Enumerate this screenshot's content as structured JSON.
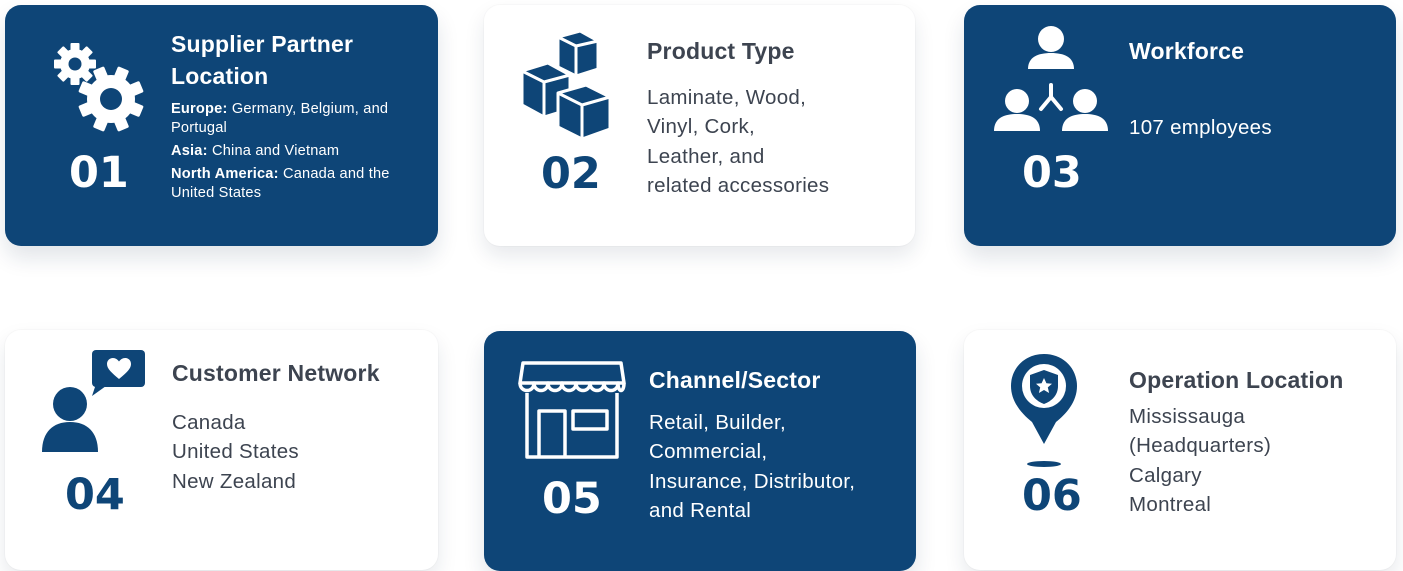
{
  "cards": [
    {
      "number": "01",
      "title_line1": "Supplier Partner",
      "title_line2": "Location",
      "icon": "gears-icon",
      "locations": [
        {
          "region": "Europe:",
          "countries": "Germany, Belgium, and Portugal"
        },
        {
          "region": "Asia:",
          "countries": "China and Vietnam"
        },
        {
          "region": "North America:",
          "countries": "Canada and the United States"
        }
      ]
    },
    {
      "number": "02",
      "title": "Product Type",
      "icon": "boxes-icon",
      "lines": [
        "Laminate, Wood,",
        "Vinyl, Cork,",
        "Leather, and",
        "related accessories"
      ]
    },
    {
      "number": "03",
      "title": "Workforce",
      "icon": "team-icon",
      "lines": [
        "107 employees"
      ]
    },
    {
      "number": "04",
      "title": "Customer Network",
      "icon": "customer-chat-heart-icon",
      "lines": [
        "Canada",
        "United States",
        "New Zealand"
      ]
    },
    {
      "number": "05",
      "title": "Channel/Sector",
      "icon": "storefront-icon",
      "lines": [
        "Retail, Builder,",
        "Commercial,",
        "Insurance, Distributor,",
        "and Rental"
      ]
    },
    {
      "number": "06",
      "title": "Operation Location",
      "icon": "location-pin-shield-icon",
      "lines": [
        "Mississauga",
        "(Headquarters)",
        "Calgary",
        "Montreal"
      ]
    }
  ],
  "colors": {
    "navy": "#0e4577",
    "text_dark": "#3d4450",
    "card_light": "#ffffff"
  }
}
